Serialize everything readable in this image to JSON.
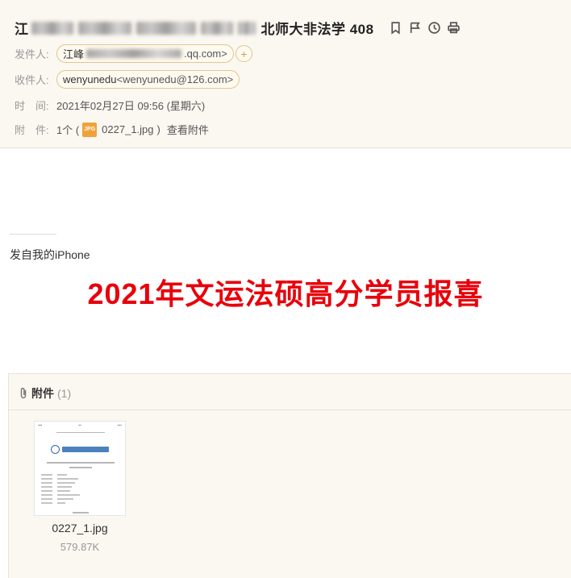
{
  "mail": {
    "subject_prefix": "江",
    "subject_suffix": "北师大非法学 408",
    "sender_label": "发件人:",
    "sender_name": "江峰",
    "sender_addr": ".qq.com>",
    "recipient_label": "收件人:",
    "recipient_name": "wenyunedu",
    "recipient_addr": "<wenyunedu@126.com>",
    "time_label": "时　间:",
    "time_value": "2021年02月27日 09:56 (星期六)",
    "attach_label": "附　件:",
    "attach_count_text": "1个 (",
    "attach_file": "0227_1.jpg",
    "attach_close": ")",
    "view_attach": "查看附件",
    "jpg_badge": "JPG"
  },
  "body": {
    "sent_from": "发自我的iPhone",
    "headline": "2021年文运法硕高分学员报喜",
    "headline_color": "#e8000b"
  },
  "attachments": {
    "title": "附件",
    "count": "(1)",
    "file_name": "0227_1.jpg",
    "file_size": "579.87K"
  },
  "icons": {
    "subject": [
      "bookmark-icon",
      "flag-icon",
      "clock-icon",
      "print-icon"
    ]
  }
}
